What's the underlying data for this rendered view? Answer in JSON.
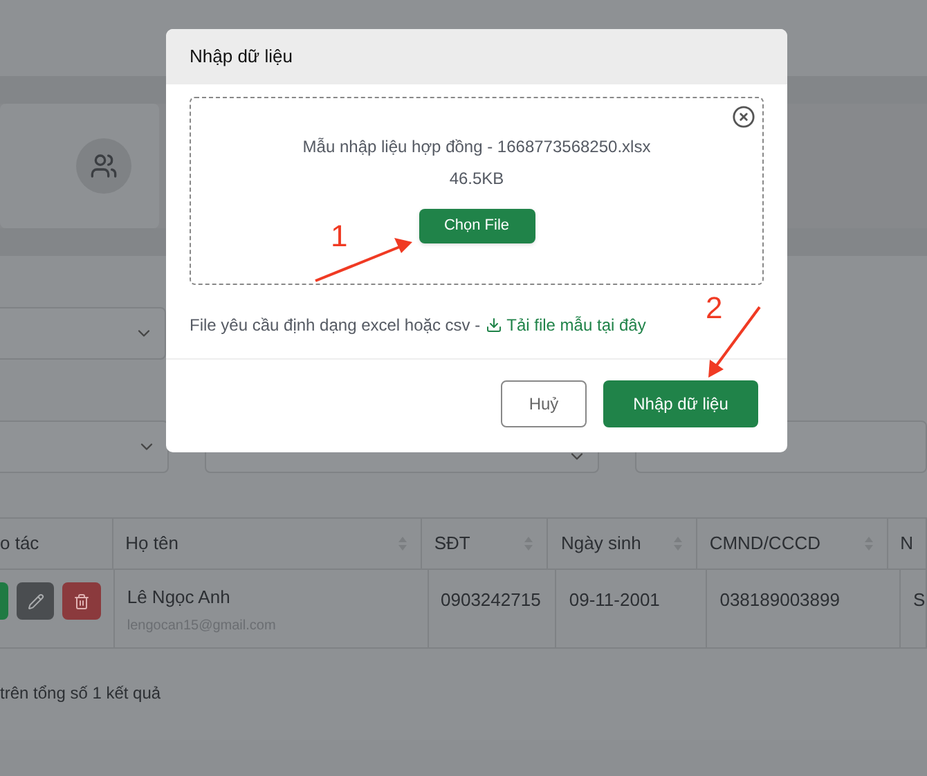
{
  "page": {
    "filters": [
      {
        "kind": "select"
      },
      {
        "kind": "select"
      },
      {
        "kind": "select"
      },
      {
        "kind": "search"
      }
    ],
    "table": {
      "columns": [
        {
          "label": "o tác",
          "sortable": false
        },
        {
          "label": "Họ tên",
          "sortable": true
        },
        {
          "label": "SĐT",
          "sortable": true
        },
        {
          "label": "Ngày sinh",
          "sortable": true
        },
        {
          "label": "CMND/CCCD",
          "sortable": true
        },
        {
          "label": "N",
          "sortable": false
        }
      ],
      "rows": [
        {
          "name": "Lê Ngọc Anh",
          "email": "lengocan15@gmail.com",
          "phone": "0903242715",
          "birthday": "09-11-2001",
          "id_number": "038189003899",
          "column_6": "S"
        }
      ]
    },
    "summary": "trên tổng số 1 kết quả"
  },
  "dialog": {
    "title": "Nhập dữ liệu",
    "file_name": "Mẫu nhập liệu hợp đồng - 1668773568250.xlsx",
    "file_size": "46.5KB",
    "choose_button": "Chọn File",
    "hint": "File yêu cầu định dạng excel hoặc csv -",
    "download_link": "Tải file mẫu tại đây",
    "cancel_button": "Huỷ",
    "submit_button": "Nhập dữ liệu"
  },
  "annotations": [
    {
      "label": "1"
    },
    {
      "label": "2"
    }
  ]
}
